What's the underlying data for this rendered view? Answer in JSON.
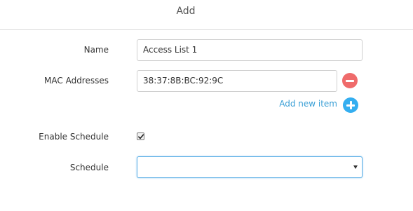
{
  "dialog": {
    "title": "Add"
  },
  "form": {
    "name": {
      "label": "Name",
      "value": "Access List 1"
    },
    "mac_addresses": {
      "label": "MAC Addresses",
      "items": [
        "38:37:8B:BC:92:9C"
      ],
      "add_label": "Add new item"
    },
    "enable_schedule": {
      "label": "Enable Schedule",
      "checked": true
    },
    "schedule": {
      "label": "Schedule",
      "selected": ""
    }
  },
  "colors": {
    "remove_button": "#ef6b6b",
    "add_button": "#34aef0",
    "link": "#3a9fd6",
    "focus_border": "#5aaee6"
  },
  "icons": {
    "remove": "minus-circle-icon",
    "add": "plus-circle-icon",
    "check": "checkmark-icon",
    "dropdown": "caret-down-icon"
  }
}
